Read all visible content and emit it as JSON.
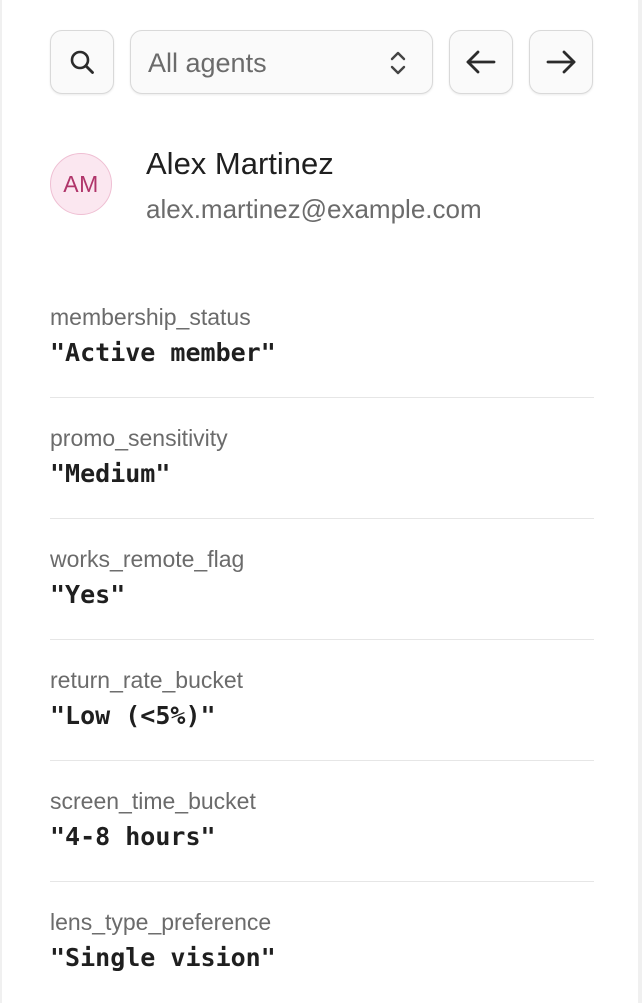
{
  "toolbar": {
    "search_icon": "search-icon",
    "agent_filter": {
      "selected": "All agents",
      "icon": "chevrons-up-down-icon"
    },
    "prev_icon": "arrow-left-icon",
    "next_icon": "arrow-right-icon"
  },
  "profile": {
    "initials": "AM",
    "name": "Alex Martinez",
    "email": "alex.martinez@example.com",
    "avatar_bg": "#fbe7f0",
    "avatar_fg": "#b0356a"
  },
  "attributes": [
    {
      "key": "membership_status",
      "value": "\"Active member\""
    },
    {
      "key": "promo_sensitivity",
      "value": "\"Medium\""
    },
    {
      "key": "works_remote_flag",
      "value": "\"Yes\""
    },
    {
      "key": "return_rate_bucket",
      "value": "\"Low (<5%)\""
    },
    {
      "key": "screen_time_bucket",
      "value": "\"4-8 hours\""
    },
    {
      "key": "lens_type_preference",
      "value": "\"Single vision\""
    }
  ]
}
